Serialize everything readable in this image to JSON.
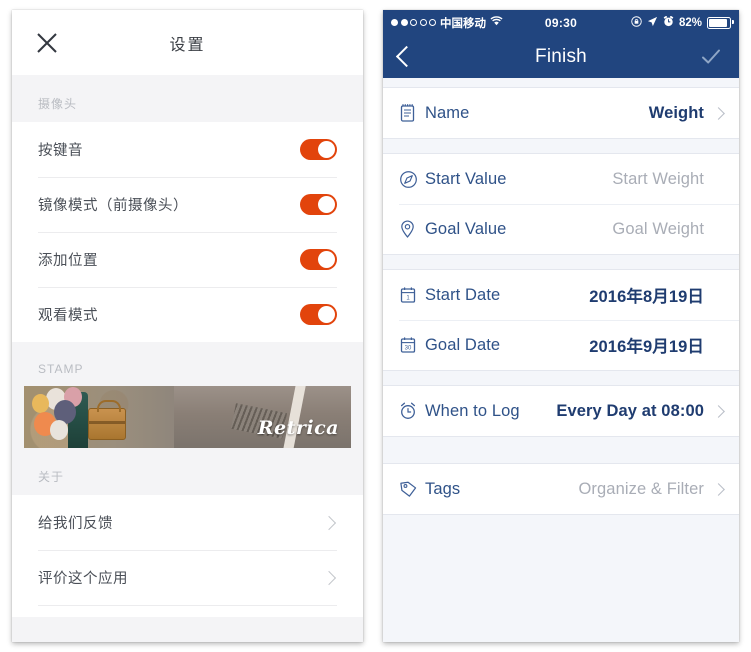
{
  "left_phone": {
    "header": {
      "title": "设置",
      "close_icon": "close-icon"
    },
    "sections": [
      {
        "label": "摄像头",
        "rows": [
          {
            "label": "按键音",
            "control": "toggle",
            "state": "on"
          },
          {
            "label": "镜像模式（前摄像头）",
            "control": "toggle",
            "state": "on"
          },
          {
            "label": "添加位置",
            "control": "toggle",
            "state": "on"
          },
          {
            "label": "观看模式",
            "control": "toggle",
            "state": "on"
          }
        ]
      },
      {
        "label": "STAMP",
        "stamp": {
          "brand": "Retrica",
          "alt": "balloons-and-suitcase-on-road-photo"
        }
      },
      {
        "label": "关于",
        "rows": [
          {
            "label": "给我们反馈",
            "control": "chevron"
          },
          {
            "label": "评价这个应用",
            "control": "chevron"
          }
        ]
      }
    ],
    "accent_color": "#e2440c"
  },
  "right_phone": {
    "status_bar": {
      "signal_dots": "●●○○○",
      "carrier": "中国移动",
      "wifi_icon": "wifi-icon",
      "time": "09:30",
      "rotation_lock_icon": "rotation-lock-icon",
      "location_icon": "location-arrow-icon",
      "alarm_icon": "alarm-clock-icon",
      "battery_percent": "82%",
      "battery_icon": "battery-icon"
    },
    "nav_bar": {
      "back_icon": "chevron-left-icon",
      "title": "Finish",
      "confirm_icon": "check-icon"
    },
    "groups": [
      {
        "rows": [
          {
            "icon": "notepad-icon",
            "label": "Name",
            "value": "Weight",
            "value_style": "strong",
            "chevron": true
          }
        ]
      },
      {
        "rows": [
          {
            "icon": "compass-icon",
            "label": "Start Value",
            "value": "Start Weight",
            "value_style": "muted",
            "chevron": false
          },
          {
            "icon": "map-pin-icon",
            "label": "Goal Value",
            "value": "Goal Weight",
            "value_style": "muted",
            "chevron": false
          }
        ]
      },
      {
        "rows": [
          {
            "icon": "calendar-1-icon",
            "label": "Start Date",
            "value": "2016年8月19日",
            "value_style": "strong",
            "chevron": false
          },
          {
            "icon": "calendar-30-icon",
            "label": "Goal Date",
            "value": "2016年9月19日",
            "value_style": "strong",
            "chevron": false
          }
        ]
      },
      {
        "rows": [
          {
            "icon": "alarm-clock-icon",
            "label": "When to Log",
            "value": "Every Day at 08:00",
            "value_style": "strong",
            "chevron": true
          }
        ]
      },
      {
        "rows": [
          {
            "icon": "tag-icon",
            "label": "Tags",
            "value": "Organize & Filter",
            "value_style": "muted",
            "chevron": true
          }
        ]
      }
    ],
    "nav_color": "#21457f",
    "label_color": "#2f5288"
  }
}
